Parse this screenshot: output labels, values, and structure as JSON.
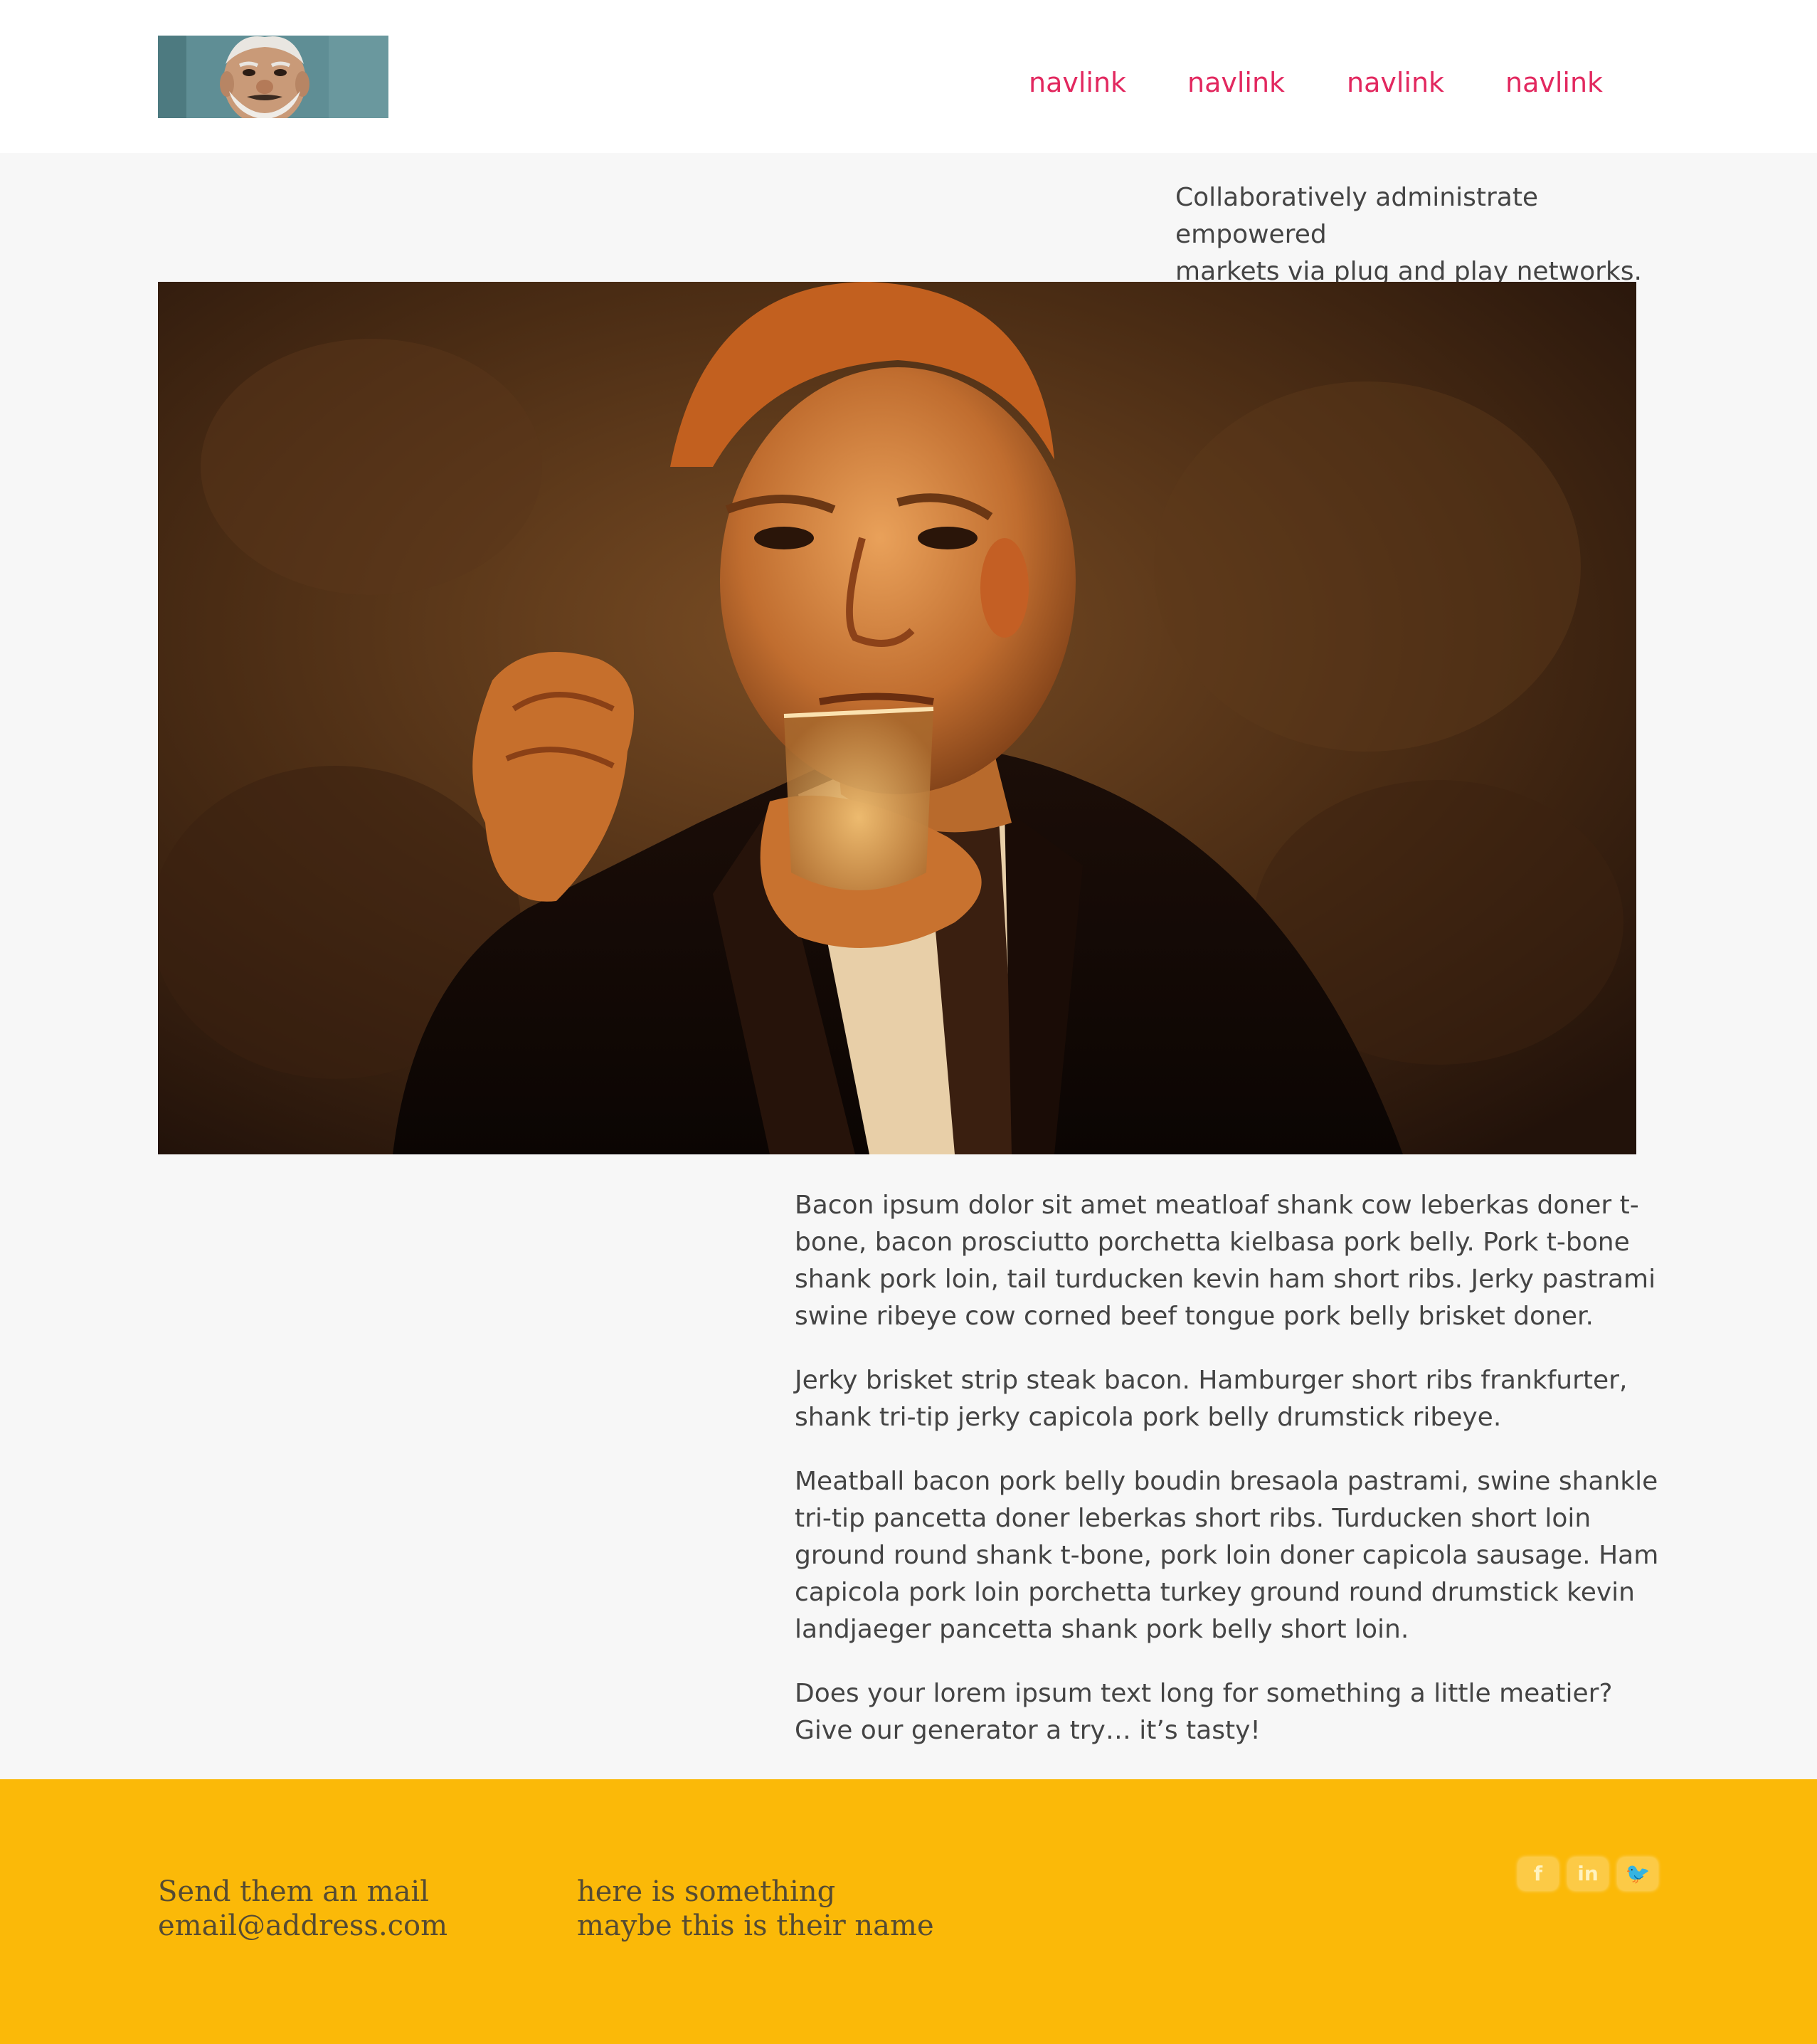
{
  "header": {
    "logo_alt": "",
    "nav": [
      {
        "label": "navlink"
      },
      {
        "label": "navlink"
      },
      {
        "label": "navlink"
      },
      {
        "label": "navlink"
      }
    ]
  },
  "tagline": {
    "line1": "Collaboratively administrate empowered",
    "line2": "markets via plug and play networks."
  },
  "article": {
    "paragraphs": [
      "Bacon ipsum dolor sit amet meatloaf shank cow leberkas doner t-bone, bacon prosciutto porchetta kielbasa pork belly. Pork t-bone shank pork loin, tail turducken kevin ham short ribs. Jerky pastrami swine ribeye cow corned beef tongue pork belly brisket doner.",
      "Jerky brisket strip steak bacon. Hamburger short ribs frankfurter, shank tri-tip jerky capicola pork belly drumstick ribeye.",
      "Meatball bacon pork belly boudin bresaola pastrami, swine shankle tri-tip pancetta doner leberkas short ribs. Turducken short loin ground round shank t-bone, pork loin doner capicola sausage. Ham capicola pork loin porchetta turkey ground round drumstick kevin landjaeger pancetta shank pork belly short loin.",
      "Does your lorem ipsum text long for something a little meatier? Give our generator a try… it’s tasty!"
    ]
  },
  "footer": {
    "contact": {
      "line1": "Send them an mail",
      "line2": "email@address.com"
    },
    "info": {
      "line1": "here is something",
      "line2": "maybe this is their name"
    },
    "social": [
      {
        "icon": "facebook-icon",
        "glyph": "f"
      },
      {
        "icon": "linkedin-icon",
        "glyph": "in"
      },
      {
        "icon": "twitter-icon",
        "glyph": "🐦"
      }
    ]
  },
  "colors": {
    "nav_link": "#e2285f",
    "footer_bg": "#fbb908",
    "page_bg": "#f7f7f7",
    "header_bg": "#ffffff"
  }
}
